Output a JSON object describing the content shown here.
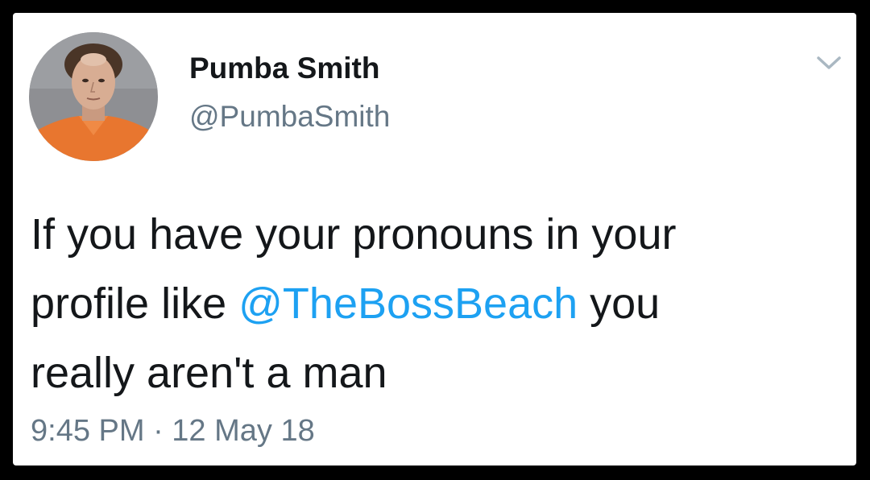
{
  "tweet": {
    "author": {
      "display_name": "Pumba Smith",
      "handle": "@PumbaSmith",
      "avatar_icon": "profile-photo-avatar"
    },
    "menu_icon": "chevron-down-icon",
    "text": {
      "line1": "If you have your pronouns in your",
      "line2_start": "profile like ",
      "mention": "@TheBossBeach",
      "line2_end": " you",
      "line3": "really aren't a man"
    },
    "timestamp": "9:45 PM · 12 May 18"
  },
  "colors": {
    "background": "#000000",
    "card": "#ffffff",
    "name_text": "#14171a",
    "secondary_text": "#657786",
    "link": "#1da1f2"
  }
}
